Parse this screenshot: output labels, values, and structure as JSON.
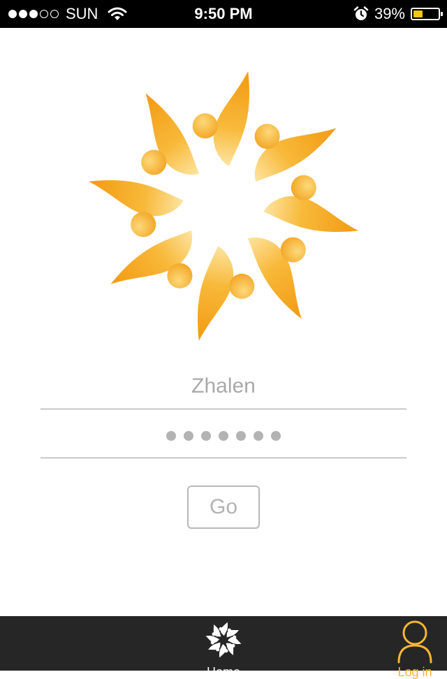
{
  "status_bar": {
    "carrier": "SUN",
    "signal_bars_filled": 3,
    "signal_bars_total": 5,
    "time": "9:50 PM",
    "battery_percent": "39%",
    "battery_level": 0.39,
    "icons": [
      "signal-icon",
      "wifi-icon",
      "alarm-icon",
      "battery-icon"
    ]
  },
  "logo": {
    "icon": "sun-swirl-logo",
    "colors": [
      "#f4a51f",
      "#fcd76b"
    ]
  },
  "login_form": {
    "username_value": "Zhalen",
    "password_mask_count": 7,
    "go_label": "Go"
  },
  "tab_bar": {
    "tabs": [
      {
        "label": "Home",
        "icon": "home-logo-icon",
        "active": false
      },
      {
        "label": "Log in",
        "icon": "user-icon",
        "active": true
      }
    ],
    "active_color": "#f5b731"
  }
}
